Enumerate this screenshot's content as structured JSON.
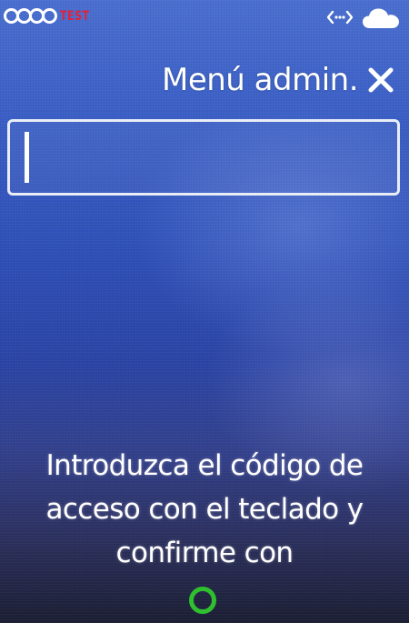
{
  "status_bar": {
    "brand_suffix": "TEST",
    "brand_suffix_color": "#e2223a",
    "connection_icon": "link-arrows-icon",
    "cloud_icon": "cloud-icon"
  },
  "header": {
    "title": "Menú admin.",
    "close_icon": "close-icon"
  },
  "code_input": {
    "value": ""
  },
  "instructions": {
    "lines": [
      "Introduzca el código de",
      "acceso con el teclado y",
      "confirme con"
    ]
  },
  "confirm_key": {
    "icon": "green-circle-key-icon",
    "color": "#2fbf2f"
  },
  "colors": {
    "background_top": "#4a6fd0",
    "background_bottom": "#1c1e33",
    "text": "#ffffff"
  }
}
